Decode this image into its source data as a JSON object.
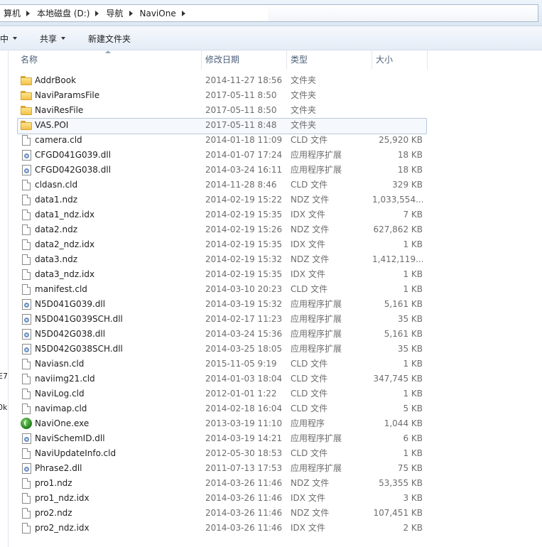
{
  "breadcrumb": [
    "算机",
    "本地磁盘 (D:)",
    "导航",
    "NaviOne"
  ],
  "toolbar": {
    "include_label": "中",
    "share_label": "共享",
    "new_folder_label": "新建文件夹"
  },
  "nav_fragments": [
    "E7",
    "0k"
  ],
  "columns": {
    "name": "名称",
    "date": "修改日期",
    "type": "类型",
    "size": "大小"
  },
  "files": [
    {
      "name": "AddrBook",
      "date": "2014-11-27 18:56",
      "type": "文件夹",
      "size": "",
      "icon": "folder-icon"
    },
    {
      "name": "NaviParamsFile",
      "date": "2017-05-11 8:50",
      "type": "文件夹",
      "size": "",
      "icon": "folder-icon"
    },
    {
      "name": "NaviResFile",
      "date": "2017-05-11 8:50",
      "type": "文件夹",
      "size": "",
      "icon": "folder-icon"
    },
    {
      "name": "VAS.POI",
      "date": "2017-05-11 8:48",
      "type": "文件夹",
      "size": "",
      "icon": "folder-icon",
      "selected": true
    },
    {
      "name": "camera.cld",
      "date": "2014-01-18 11:09",
      "type": "CLD 文件",
      "size": "25,920 KB",
      "icon": "file-icon"
    },
    {
      "name": "CFGD041G039.dll",
      "date": "2014-01-07 17:24",
      "type": "应用程序扩展",
      "size": "18 KB",
      "icon": "dll-icon"
    },
    {
      "name": "CFGD042G038.dll",
      "date": "2014-03-24 16:11",
      "type": "应用程序扩展",
      "size": "18 KB",
      "icon": "dll-icon"
    },
    {
      "name": "cldasn.cld",
      "date": "2014-11-28 8:46",
      "type": "CLD 文件",
      "size": "329 KB",
      "icon": "file-icon"
    },
    {
      "name": "data1.ndz",
      "date": "2014-02-19 15:22",
      "type": "NDZ 文件",
      "size": "1,033,554...",
      "icon": "file-icon"
    },
    {
      "name": "data1_ndz.idx",
      "date": "2014-02-19 15:35",
      "type": "IDX 文件",
      "size": "7 KB",
      "icon": "file-icon"
    },
    {
      "name": "data2.ndz",
      "date": "2014-02-19 15:26",
      "type": "NDZ 文件",
      "size": "627,862 KB",
      "icon": "file-icon"
    },
    {
      "name": "data2_ndz.idx",
      "date": "2014-02-19 15:35",
      "type": "IDX 文件",
      "size": "1 KB",
      "icon": "file-icon"
    },
    {
      "name": "data3.ndz",
      "date": "2014-02-19 15:32",
      "type": "NDZ 文件",
      "size": "1,412,119...",
      "icon": "file-icon"
    },
    {
      "name": "data3_ndz.idx",
      "date": "2014-02-19 15:35",
      "type": "IDX 文件",
      "size": "1 KB",
      "icon": "file-icon"
    },
    {
      "name": "manifest.cld",
      "date": "2014-03-10 20:23",
      "type": "CLD 文件",
      "size": "1 KB",
      "icon": "file-icon"
    },
    {
      "name": "N5D041G039.dll",
      "date": "2014-03-19 15:32",
      "type": "应用程序扩展",
      "size": "5,161 KB",
      "icon": "dll-icon"
    },
    {
      "name": "N5D041G039SCH.dll",
      "date": "2014-02-17 11:23",
      "type": "应用程序扩展",
      "size": "35 KB",
      "icon": "dll-icon"
    },
    {
      "name": "N5D042G038.dll",
      "date": "2014-03-24 15:36",
      "type": "应用程序扩展",
      "size": "5,161 KB",
      "icon": "dll-icon"
    },
    {
      "name": "N5D042G038SCH.dll",
      "date": "2014-03-25 18:05",
      "type": "应用程序扩展",
      "size": "35 KB",
      "icon": "dll-icon"
    },
    {
      "name": "Naviasn.cld",
      "date": "2015-11-05 9:19",
      "type": "CLD 文件",
      "size": "1 KB",
      "icon": "file-icon"
    },
    {
      "name": "naviimg21.cld",
      "date": "2014-01-03 18:04",
      "type": "CLD 文件",
      "size": "347,745 KB",
      "icon": "file-icon"
    },
    {
      "name": "NaviLog.cld",
      "date": "2012-01-01 1:22",
      "type": "CLD 文件",
      "size": "1 KB",
      "icon": "file-icon"
    },
    {
      "name": "navimap.cld",
      "date": "2014-02-18 16:04",
      "type": "CLD 文件",
      "size": "5 KB",
      "icon": "file-icon"
    },
    {
      "name": "NaviOne.exe",
      "date": "2013-03-19 11:10",
      "type": "应用程序",
      "size": "1,044 KB",
      "icon": "exe-icon"
    },
    {
      "name": "NaviSchemID.dll",
      "date": "2014-03-19 14:21",
      "type": "应用程序扩展",
      "size": "6 KB",
      "icon": "dll-icon"
    },
    {
      "name": "NaviUpdateInfo.cld",
      "date": "2012-05-30 18:53",
      "type": "CLD 文件",
      "size": "1 KB",
      "icon": "file-icon"
    },
    {
      "name": "Phrase2.dll",
      "date": "2011-07-13 17:53",
      "type": "应用程序扩展",
      "size": "75 KB",
      "icon": "dll-icon"
    },
    {
      "name": "pro1.ndz",
      "date": "2014-03-26 11:46",
      "type": "NDZ 文件",
      "size": "53,355 KB",
      "icon": "file-icon"
    },
    {
      "name": "pro1_ndz.idx",
      "date": "2014-03-26 11:46",
      "type": "IDX 文件",
      "size": "3 KB",
      "icon": "file-icon"
    },
    {
      "name": "pro2.ndz",
      "date": "2014-03-26 11:46",
      "type": "NDZ 文件",
      "size": "107,451 KB",
      "icon": "file-icon"
    },
    {
      "name": "pro2_ndz.idx",
      "date": "2014-03-26 11:46",
      "type": "IDX 文件",
      "size": "2 KB",
      "icon": "file-icon"
    }
  ]
}
